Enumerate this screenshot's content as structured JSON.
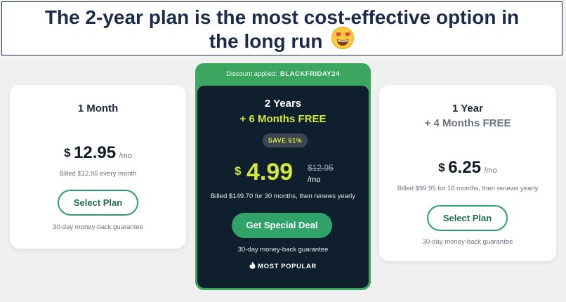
{
  "caption": {
    "line1": "The 2-year plan is the most cost-effective option in",
    "line2": "the long run"
  },
  "plans": [
    {
      "name": "1 Month",
      "currency": "$",
      "price": "12.95",
      "per": "/mo",
      "billed": "Billed $12.95 every month",
      "button": "Select Plan",
      "guarantee": "30-day money-back guarantee"
    },
    {
      "discount_label": "Discount applied:",
      "discount_code": "BLACKFRIDAY24",
      "name": "2 Years",
      "extra": "+ 6 Months FREE",
      "save": "SAVE 61%",
      "currency": "$",
      "price": "4.99",
      "old_price": "$12.95",
      "per": "/mo",
      "billed": "Billed $149.70 for 30 months, then renews yearly",
      "button": "Get Special Deal",
      "guarantee": "30-day money-back guarantee",
      "badge": "MOST POPULAR"
    },
    {
      "name": "1 Year",
      "extra": "+ 4 Months FREE",
      "currency": "$",
      "price": "6.25",
      "per": "/mo",
      "billed": "Billed $99.95 for 16 months, then renews yearly",
      "button": "Select Plan",
      "guarantee": "30-day money-back guarantee"
    }
  ],
  "icons": {
    "caption_emoji": "heart-eyes-emoji-icon",
    "popular": "flame-icon"
  },
  "colors": {
    "accent_green": "#2fa36a",
    "highlight_yellow": "#d4e83a",
    "featured_bg": "#0f1f2e",
    "caption_text": "#1c2b4a"
  }
}
